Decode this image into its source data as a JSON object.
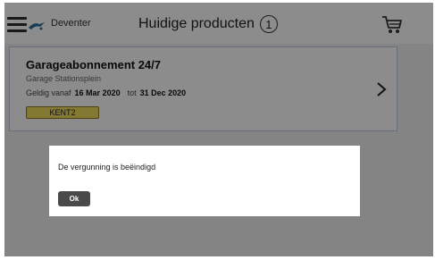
{
  "header": {
    "location": "Deventer",
    "title": "Huidige producten",
    "product_count": "1",
    "icons": [
      "menu-icon",
      "logo-icon",
      "cart-icon"
    ]
  },
  "product": {
    "title": "Garageabonnement 24/7",
    "subtitle": "Garage Stationsplein",
    "valid_from_label": "Geldig vanaf",
    "valid_from": "16 Mar 2020",
    "valid_to_label": "tot",
    "valid_to": "31 Dec 2020",
    "plate": "KENT2"
  },
  "dialog": {
    "message": "De vergunning is beëindigd",
    "ok_label": "Ok"
  },
  "colors": {
    "plate_background": "#f1dc5c",
    "button_background": "#4a4a4a",
    "card_border": "#b9c8de"
  }
}
